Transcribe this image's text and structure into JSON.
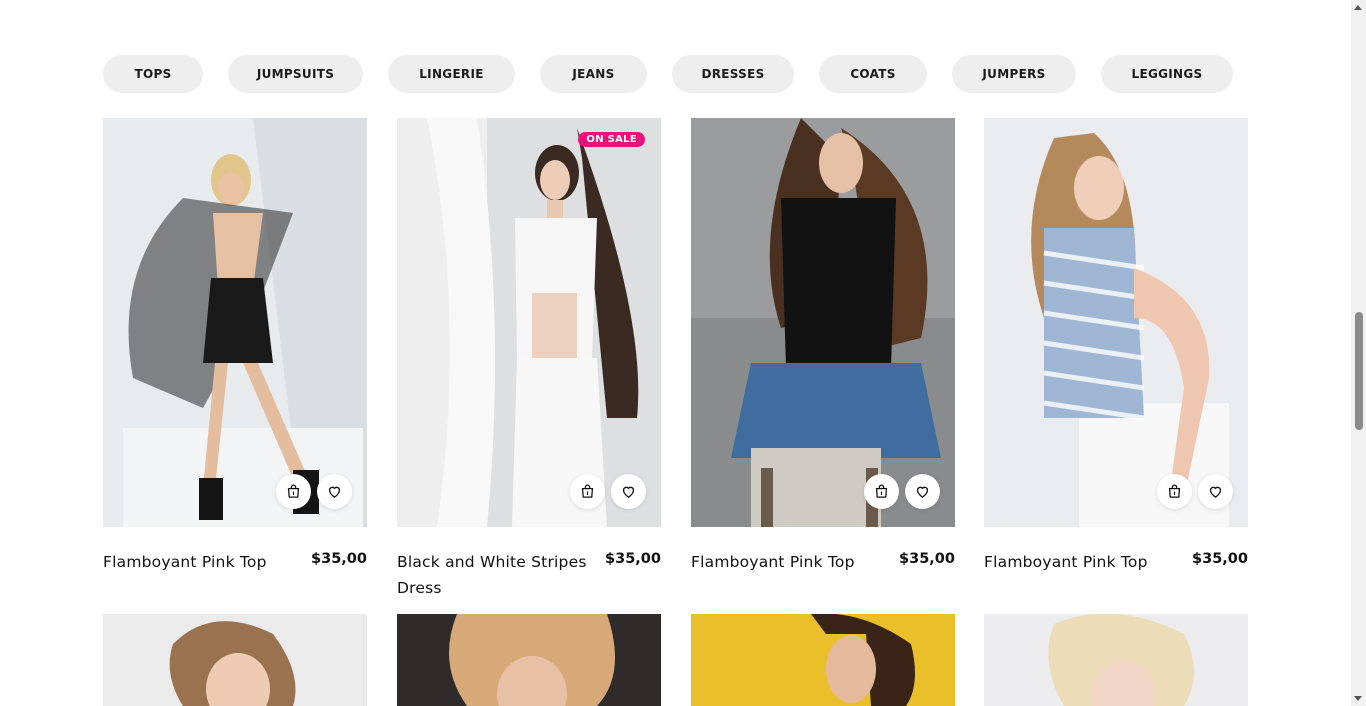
{
  "categories": [
    "TOPS",
    "JUMPSUITS",
    "LINGERIE",
    "JEANS",
    "DRESSES",
    "COATS",
    "JUMPERS",
    "LEGGINGS"
  ],
  "products": [
    {
      "title": "Flamboyant Pink Top",
      "price": "$35,00",
      "badge": ""
    },
    {
      "title": "Black and White Stripes Dress",
      "price": "$35,00",
      "badge": "ON SALE"
    },
    {
      "title": "Flamboyant Pink Top",
      "price": "$35,00",
      "badge": ""
    },
    {
      "title": "Flamboyant Pink Top",
      "price": "$35,00",
      "badge": ""
    }
  ],
  "icons": {
    "cart": "shopping-bag-icon",
    "wishlist": "heart-icon"
  },
  "colors": {
    "sale_badge": "#e8127c",
    "pill_bg": "#eeeeee"
  }
}
